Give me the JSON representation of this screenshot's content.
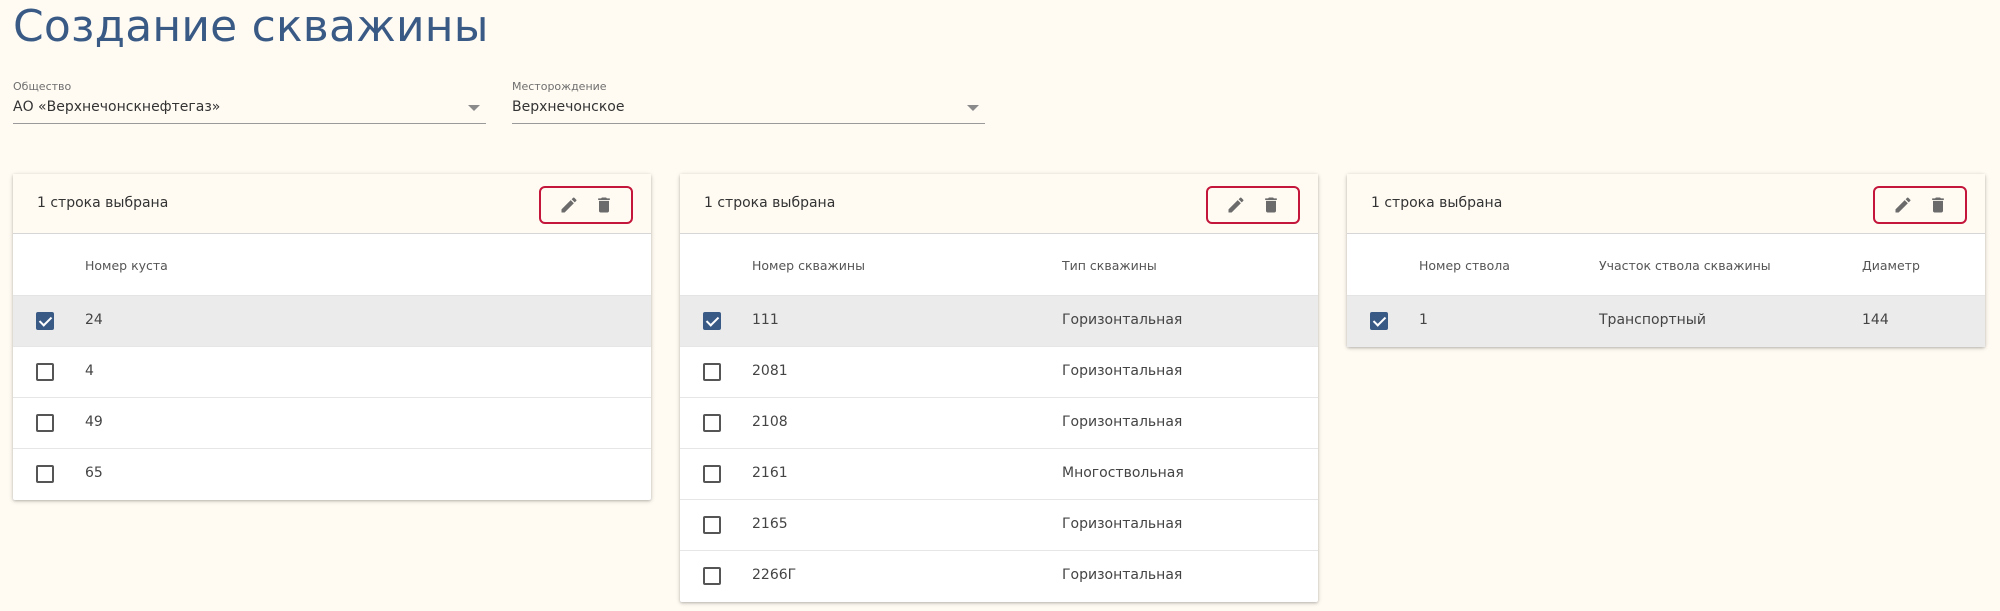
{
  "page": {
    "title": "Создание скважины"
  },
  "filters": {
    "company": {
      "label": "Общество",
      "value": "АО «Верхнечонскнефтегаз»"
    },
    "field": {
      "label": "Месторождение",
      "value": "Верхнечонское"
    }
  },
  "tables": {
    "pads": {
      "selection_text": "1 строка выбрана",
      "columns": [
        "Номер куста"
      ],
      "rows": [
        {
          "checked": true,
          "cells": [
            "24"
          ]
        },
        {
          "checked": false,
          "cells": [
            "4"
          ]
        },
        {
          "checked": false,
          "cells": [
            "49"
          ]
        },
        {
          "checked": false,
          "cells": [
            "65"
          ]
        }
      ]
    },
    "wells": {
      "selection_text": "1 строка выбрана",
      "columns": [
        "Номер скважины",
        "Тип скважины"
      ],
      "rows": [
        {
          "checked": true,
          "cells": [
            "111",
            "Горизонтальная"
          ]
        },
        {
          "checked": false,
          "cells": [
            "2081",
            "Горизонтальная"
          ]
        },
        {
          "checked": false,
          "cells": [
            "2108",
            "Горизонтальная"
          ]
        },
        {
          "checked": false,
          "cells": [
            "2161",
            "Многоствольная"
          ]
        },
        {
          "checked": false,
          "cells": [
            "2165",
            "Горизонтальная"
          ]
        },
        {
          "checked": false,
          "cells": [
            "2266Г",
            "Горизонтальная"
          ]
        }
      ]
    },
    "bores": {
      "selection_text": "1 строка выбрана",
      "columns": [
        "Номер ствола",
        "Участок ствола скважины",
        "Диаметр"
      ],
      "rows": [
        {
          "checked": true,
          "cells": [
            "1",
            "Транспортный",
            "144"
          ]
        }
      ]
    }
  },
  "icons": {
    "edit": "pencil-icon",
    "delete": "trash-icon"
  },
  "colors": {
    "title": "#3a5a86",
    "accent": "#3a5a86",
    "highlight_border": "#c3163a",
    "background": "#fffbf3"
  }
}
